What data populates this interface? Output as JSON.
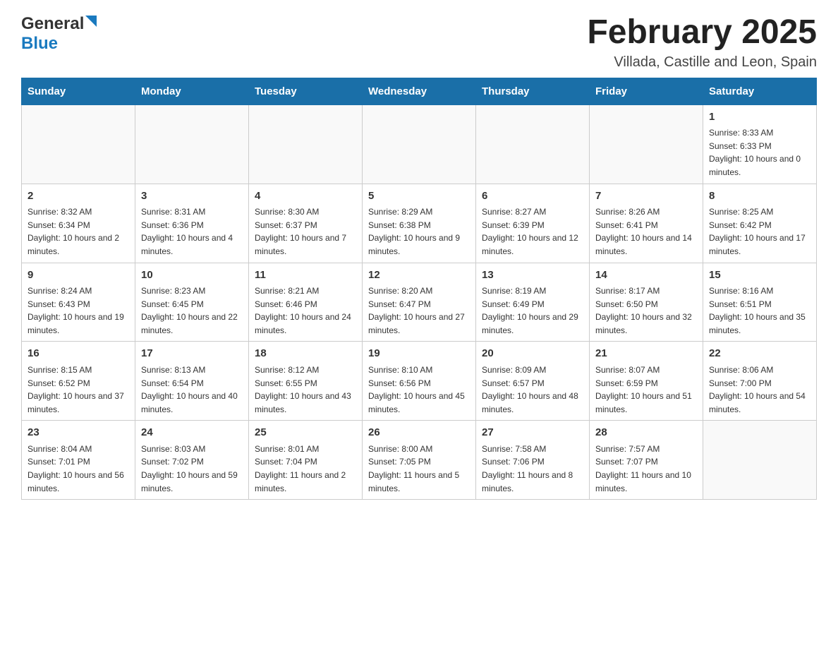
{
  "header": {
    "logo_general": "General",
    "logo_blue": "Blue",
    "month_title": "February 2025",
    "location": "Villada, Castille and Leon, Spain"
  },
  "weekdays": [
    "Sunday",
    "Monday",
    "Tuesday",
    "Wednesday",
    "Thursday",
    "Friday",
    "Saturday"
  ],
  "weeks": [
    [
      {
        "day": "",
        "info": ""
      },
      {
        "day": "",
        "info": ""
      },
      {
        "day": "",
        "info": ""
      },
      {
        "day": "",
        "info": ""
      },
      {
        "day": "",
        "info": ""
      },
      {
        "day": "",
        "info": ""
      },
      {
        "day": "1",
        "info": "Sunrise: 8:33 AM\nSunset: 6:33 PM\nDaylight: 10 hours and 0 minutes."
      }
    ],
    [
      {
        "day": "2",
        "info": "Sunrise: 8:32 AM\nSunset: 6:34 PM\nDaylight: 10 hours and 2 minutes."
      },
      {
        "day": "3",
        "info": "Sunrise: 8:31 AM\nSunset: 6:36 PM\nDaylight: 10 hours and 4 minutes."
      },
      {
        "day": "4",
        "info": "Sunrise: 8:30 AM\nSunset: 6:37 PM\nDaylight: 10 hours and 7 minutes."
      },
      {
        "day": "5",
        "info": "Sunrise: 8:29 AM\nSunset: 6:38 PM\nDaylight: 10 hours and 9 minutes."
      },
      {
        "day": "6",
        "info": "Sunrise: 8:27 AM\nSunset: 6:39 PM\nDaylight: 10 hours and 12 minutes."
      },
      {
        "day": "7",
        "info": "Sunrise: 8:26 AM\nSunset: 6:41 PM\nDaylight: 10 hours and 14 minutes."
      },
      {
        "day": "8",
        "info": "Sunrise: 8:25 AM\nSunset: 6:42 PM\nDaylight: 10 hours and 17 minutes."
      }
    ],
    [
      {
        "day": "9",
        "info": "Sunrise: 8:24 AM\nSunset: 6:43 PM\nDaylight: 10 hours and 19 minutes."
      },
      {
        "day": "10",
        "info": "Sunrise: 8:23 AM\nSunset: 6:45 PM\nDaylight: 10 hours and 22 minutes."
      },
      {
        "day": "11",
        "info": "Sunrise: 8:21 AM\nSunset: 6:46 PM\nDaylight: 10 hours and 24 minutes."
      },
      {
        "day": "12",
        "info": "Sunrise: 8:20 AM\nSunset: 6:47 PM\nDaylight: 10 hours and 27 minutes."
      },
      {
        "day": "13",
        "info": "Sunrise: 8:19 AM\nSunset: 6:49 PM\nDaylight: 10 hours and 29 minutes."
      },
      {
        "day": "14",
        "info": "Sunrise: 8:17 AM\nSunset: 6:50 PM\nDaylight: 10 hours and 32 minutes."
      },
      {
        "day": "15",
        "info": "Sunrise: 8:16 AM\nSunset: 6:51 PM\nDaylight: 10 hours and 35 minutes."
      }
    ],
    [
      {
        "day": "16",
        "info": "Sunrise: 8:15 AM\nSunset: 6:52 PM\nDaylight: 10 hours and 37 minutes."
      },
      {
        "day": "17",
        "info": "Sunrise: 8:13 AM\nSunset: 6:54 PM\nDaylight: 10 hours and 40 minutes."
      },
      {
        "day": "18",
        "info": "Sunrise: 8:12 AM\nSunset: 6:55 PM\nDaylight: 10 hours and 43 minutes."
      },
      {
        "day": "19",
        "info": "Sunrise: 8:10 AM\nSunset: 6:56 PM\nDaylight: 10 hours and 45 minutes."
      },
      {
        "day": "20",
        "info": "Sunrise: 8:09 AM\nSunset: 6:57 PM\nDaylight: 10 hours and 48 minutes."
      },
      {
        "day": "21",
        "info": "Sunrise: 8:07 AM\nSunset: 6:59 PM\nDaylight: 10 hours and 51 minutes."
      },
      {
        "day": "22",
        "info": "Sunrise: 8:06 AM\nSunset: 7:00 PM\nDaylight: 10 hours and 54 minutes."
      }
    ],
    [
      {
        "day": "23",
        "info": "Sunrise: 8:04 AM\nSunset: 7:01 PM\nDaylight: 10 hours and 56 minutes."
      },
      {
        "day": "24",
        "info": "Sunrise: 8:03 AM\nSunset: 7:02 PM\nDaylight: 10 hours and 59 minutes."
      },
      {
        "day": "25",
        "info": "Sunrise: 8:01 AM\nSunset: 7:04 PM\nDaylight: 11 hours and 2 minutes."
      },
      {
        "day": "26",
        "info": "Sunrise: 8:00 AM\nSunset: 7:05 PM\nDaylight: 11 hours and 5 minutes."
      },
      {
        "day": "27",
        "info": "Sunrise: 7:58 AM\nSunset: 7:06 PM\nDaylight: 11 hours and 8 minutes."
      },
      {
        "day": "28",
        "info": "Sunrise: 7:57 AM\nSunset: 7:07 PM\nDaylight: 11 hours and 10 minutes."
      },
      {
        "day": "",
        "info": ""
      }
    ]
  ]
}
